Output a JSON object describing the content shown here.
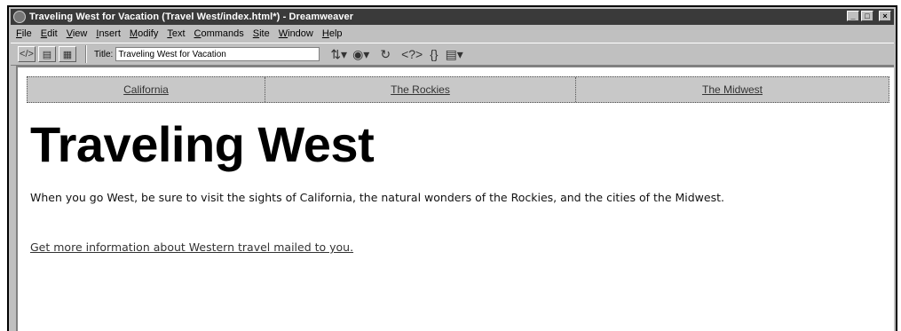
{
  "window": {
    "title": "Traveling West for Vacation (Travel West/index.html*) - Dreamweaver",
    "controls": {
      "minimize": "_",
      "maximize": "□",
      "close": "×"
    }
  },
  "menu": {
    "items": [
      "File",
      "Edit",
      "View",
      "Insert",
      "Modify",
      "Text",
      "Commands",
      "Site",
      "Window",
      "Help"
    ],
    "underline": [
      "F",
      "E",
      "V",
      "I",
      "M",
      "T",
      "C",
      "S",
      "W",
      "H"
    ]
  },
  "toolbar": {
    "title_label": "Title:",
    "title_value": "Traveling West for Vacation",
    "icons": [
      "code-view-icon",
      "split-view-icon",
      "design-view-icon",
      "file-management-icon",
      "preview-browser-icon",
      "refresh-icon",
      "reference-icon",
      "code-navigation-icon",
      "view-options-icon"
    ]
  },
  "document": {
    "nav": [
      "California",
      "The Rockies",
      "The Midwest"
    ],
    "heading": "Traveling West",
    "paragraph": "When you go West, be sure to visit the sights of California, the natural wonders of the Rockies, and the cities of the Midwest.",
    "link_text": "Get more information about Western travel mailed to you."
  }
}
